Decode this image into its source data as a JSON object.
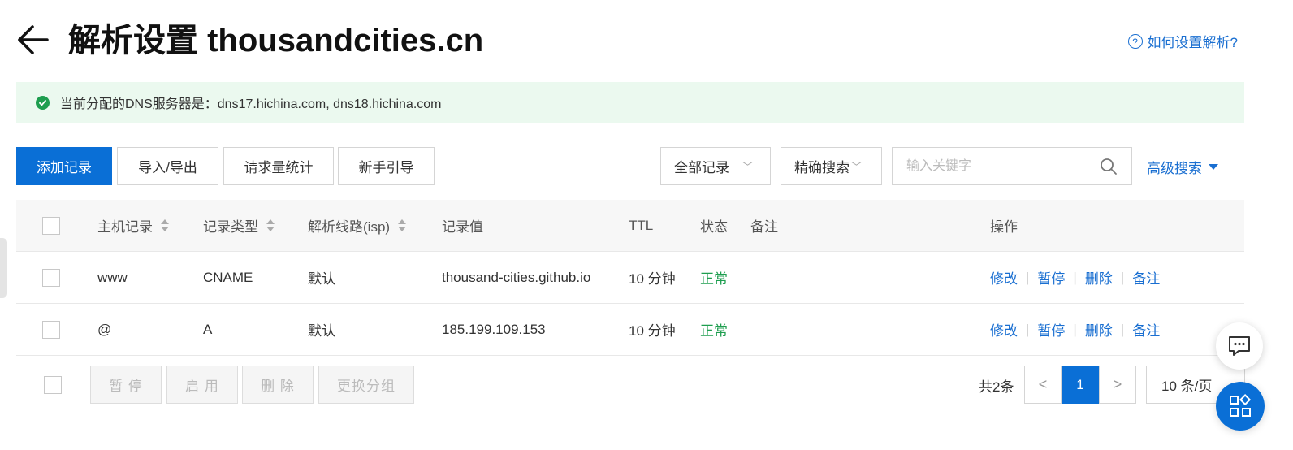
{
  "header": {
    "title": "解析设置 thousandcities.cn",
    "help_link": "如何设置解析?"
  },
  "banner": {
    "text": "当前分配的DNS服务器是：dns17.hichina.com, dns18.hichina.com"
  },
  "toolbar": {
    "add_record": "添加记录",
    "import_export": "导入/导出",
    "request_stats": "请求量统计",
    "guide": "新手引导",
    "record_filter": "全部记录",
    "search_mode": "精确搜索",
    "search_placeholder": "输入关键字",
    "advanced_search": "高级搜索"
  },
  "table": {
    "columns": {
      "host": "主机记录",
      "type": "记录类型",
      "line": "解析线路(isp)",
      "value": "记录值",
      "ttl": "TTL",
      "status": "状态",
      "remark": "备注",
      "actions": "操作"
    },
    "rows": [
      {
        "host": "www",
        "type": "CNAME",
        "line": "默认",
        "value": "thousand-cities.github.io",
        "ttl": "10 分钟",
        "status": "正常"
      },
      {
        "host": "@",
        "type": "A",
        "line": "默认",
        "value": "185.199.109.153",
        "ttl": "10 分钟",
        "status": "正常"
      }
    ],
    "actions": {
      "edit": "修改",
      "pause": "暂停",
      "delete": "删除",
      "remark": "备注"
    }
  },
  "footer": {
    "pause": "暂 停",
    "enable": "启 用",
    "delete": "删 除",
    "change_group": "更换分组",
    "total": "共2条",
    "prev": "<",
    "current_page": "1",
    "next": ">",
    "page_size": "10 条/页"
  },
  "colors": {
    "primary": "#0a6fd6",
    "link": "#1a6fd1",
    "success": "#1e9e4f",
    "banner_bg": "#ebf9ef"
  }
}
